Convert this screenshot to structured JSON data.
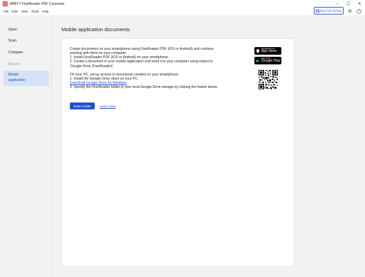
{
  "window": {
    "title": "ABBYY FineReader PDF Corporate",
    "controls": [
      "–",
      "☐",
      "✕"
    ]
  },
  "menu": [
    "File",
    "Edit",
    "View",
    "Tools",
    "Help"
  ],
  "toolbar": {
    "buy_label": "Buy Full Version",
    "icons": [
      "gear-icon",
      "help-icon"
    ]
  },
  "sidebar": {
    "items": [
      {
        "label": "Open",
        "state": "normal"
      },
      {
        "label": "Scan",
        "state": "normal"
      },
      {
        "label": "Compare",
        "state": "normal"
      },
      {
        "label": "Recent",
        "state": "disabled"
      },
      {
        "label": "Mobile application",
        "state": "active"
      }
    ]
  },
  "main": {
    "title": "Mobile application documents",
    "paragraph1": [
      "Create documents on your smartphone using FineReader PDF (iOS or Android) and continue",
      "working with them on your computer:",
      "1. Install FineReader PDF (iOS or Android) on your smartphone.",
      "2. Create a document in your mobile application and send it to your computer using export to",
      "'Google Drive (FineReader)'."
    ],
    "paragraph2_intro": [
      "On your PC, set up access to documents created on your smartphone:",
      "1. Install the Google Drive client on your PC."
    ],
    "gdrive_link": "Download Google Drive for Windows",
    "paragraph2_end": "2. Specify the FineReader folder in your local Google Drive storage by clicking the button below.",
    "select_folder_label": "Select folder",
    "learn_more_label": "Learn more",
    "app_store": {
      "sub": "Download on the",
      "main": "App Store"
    },
    "google_play": {
      "sub": "GET IT ON",
      "main": "Google Play"
    }
  },
  "colors": {
    "accent": "#1f4fd1",
    "active_nav_bg": "#d4e3f7",
    "link": "#1a56c6",
    "brand": "#d6282f"
  }
}
